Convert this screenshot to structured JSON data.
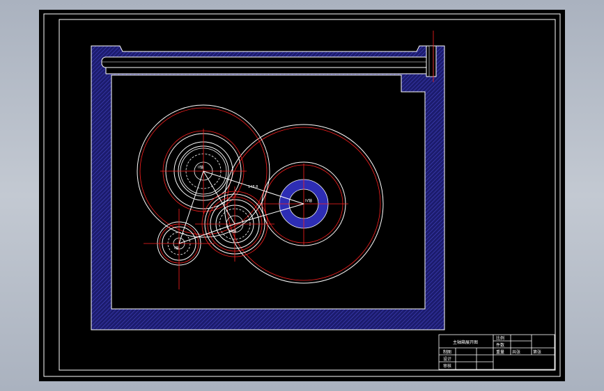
{
  "drawing": {
    "dimension_label": "148.8",
    "gear_labels": {
      "top_left": "II轴",
      "middle": "III轴",
      "small": "I轴",
      "right": "IV轴"
    }
  },
  "title_block": {
    "title": "主轴箱展开图",
    "row_labels": [
      "制图",
      "设计",
      "审核"
    ],
    "right_labels": [
      "比例",
      "件数",
      "重量",
      "共张",
      "第张"
    ]
  },
  "colors": {
    "paper": "#000000",
    "outline": "#ffffff",
    "centerline": "#ff2020",
    "hatch": "#2a2aa0",
    "bearing": "#2d2db4"
  }
}
